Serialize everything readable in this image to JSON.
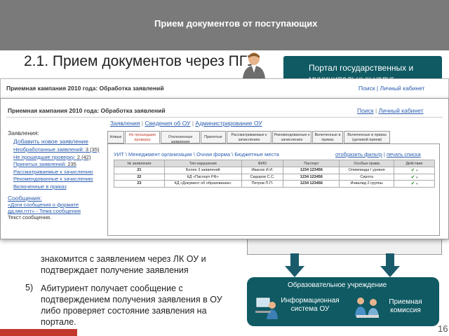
{
  "slide": {
    "header_title": "Прием документов от поступающих",
    "heading": "2.1. Прием документов через ПГУ",
    "portal_label": "Портал государственных и муниципальных услуг",
    "step4_text": "знакомится с заявлением через ЛК ОУ и подтверждает получение заявления",
    "step5_num": "5)",
    "step5_text": "Абитуриент получает сообщение с подтверждением получения заявления в ОУ либо проверяет состояние заявления на портале.",
    "ou_title": "Образовательное учреждение",
    "ou_system": "Информационная система ОУ",
    "ou_commission": "Приемная комиссия",
    "page_number": "16"
  },
  "back_window": {
    "title": "Приемная кампания 2010 года: Обработка заявлений",
    "link_search": "Поиск",
    "link_cabinet": "Личный кабинет",
    "menu": "Заявления | Сведения об ОУ | Администрирование ОУ"
  },
  "window": {
    "title": "Приемная кампания 2010 года: Обработка заявлений",
    "link_search": "Поиск",
    "link_cabinet": "Личный кабинет",
    "menu_applications": "Заявления",
    "menu_info": "Сведения об ОУ",
    "menu_admin": "Администрирование ОУ"
  },
  "sidebar": {
    "heading": "Заявления:",
    "add_new": "Добавить новое заявление",
    "items": [
      {
        "label": "Необработанные заявлений:",
        "count": "3 (35)"
      },
      {
        "label": "Не прошедшие проверку:",
        "count": "2 (42)"
      },
      {
        "label": "Принятых заявлений:",
        "count": "235"
      },
      {
        "label": "Рассматриваемые к зачислению",
        "count": ""
      },
      {
        "label": "Рекомендованные к зачислению",
        "count": ""
      },
      {
        "label": "Включенные в приказ",
        "count": ""
      }
    ],
    "messages_heading": "Сообщения:",
    "messages_link": "«Доги сообщения о формате дд.мм.гггг» - Тема сообщения",
    "messages_text": "Текст сообщения."
  },
  "tabs": [
    "Новые",
    "Не прошедшие проверку",
    "Отклоненные заявления",
    "Принятые",
    "Рассматриваемые к зачислению",
    "Рекомендованные к зачислению",
    "Включенные в приказ",
    "Включенные в приказ (целевой прием)"
  ],
  "panel": {
    "breadcrumb": "УИТ \\ Менеджмент организации \\ Очная форма \\ Бюджетные места",
    "filter_link": "отобразить фильтр",
    "print_link": "печать списка"
  },
  "table": {
    "headers": [
      "№ заявления",
      "Тип нарушения",
      "ФИО",
      "Паспорт",
      "Особые права",
      "Действие"
    ],
    "rows": [
      {
        "num": "21",
        "violation": "Более 3 заявлений",
        "fio": "Иванов И.И.",
        "passport": "1234 123456",
        "rights": "Олимпиада I уровня"
      },
      {
        "num": "22",
        "violation": "КД «Паспорт РФ»",
        "fio": "Сидоров С.С.",
        "passport": "1234 123456",
        "rights": "Сирота"
      },
      {
        "num": "23",
        "violation": "КД «Документ об образовании»",
        "fio": "Петров П.П.",
        "passport": "1234 123456",
        "rights": "Инвалид 2 группы"
      }
    ],
    "check_glyph": "✔",
    "dropdown_glyph": "▾"
  },
  "colors": {
    "header_bg": "#7a7a7a",
    "teal": "#0f5a63",
    "link": "#2a5db0",
    "active_tab": "#c0392b",
    "arrow": "#1a5b6b",
    "accent_bar": "#c0392b"
  }
}
